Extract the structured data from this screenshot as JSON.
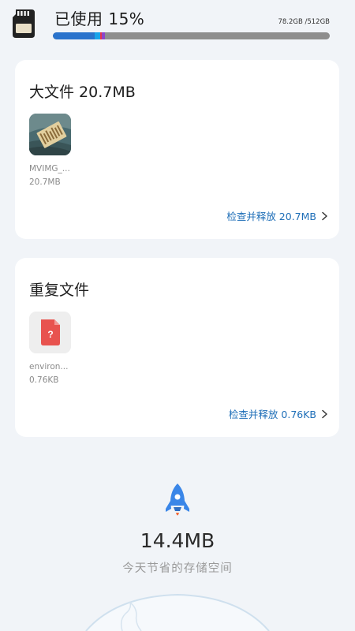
{
  "storage": {
    "title": "已使用 15%",
    "amount": "78.2GB /512GB",
    "used_percent": 15,
    "segments": [
      {
        "color": "#2a73cc",
        "fraction": 0.15
      },
      {
        "color": "#1aa3e8",
        "fraction": 0.02
      },
      {
        "color": "#e8334a",
        "fraction": 0.006
      },
      {
        "color": "#8a45c9",
        "fraction": 0.012
      }
    ],
    "bar_background": "#8e8e8e"
  },
  "large_files": {
    "title": "大文件 20.7MB",
    "items": [
      {
        "name": "MVIMG_...",
        "size": "20.7MB"
      }
    ],
    "action": "检查并释放 20.7MB"
  },
  "duplicate_files": {
    "title": "重复文件",
    "items": [
      {
        "name": "environ...",
        "size": "0.76KB"
      }
    ],
    "action": "检查并释放 0.76KB"
  },
  "summary": {
    "saved": "14.4MB",
    "label": "今天节省的存储空间"
  },
  "colors": {
    "accent": "#1f6fb8",
    "rocket": "#3a86e8",
    "unknown_file": "#e8534f",
    "page_background": "#f1f4f8"
  },
  "icons": {
    "sd_card": "sd-card-icon",
    "chevron": "chevron-right-icon",
    "rocket": "rocket-icon",
    "unknown_file": "unknown-file-icon"
  }
}
